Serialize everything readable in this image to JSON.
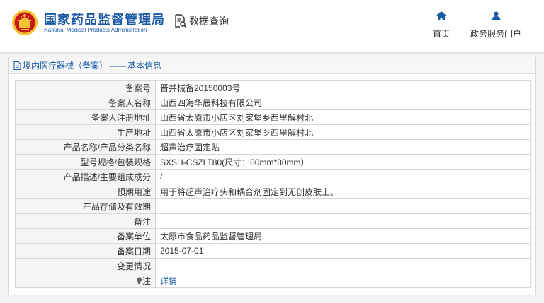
{
  "header": {
    "brand_cn": "国家药品监督管理局",
    "brand_en": "National Medical Products Administration",
    "query_label": "数据查询",
    "nav": [
      {
        "label": "首页",
        "icon": "home-icon"
      },
      {
        "label": "政务服务门户",
        "icon": "user-icon"
      }
    ]
  },
  "panel": {
    "title_left": "境内医疗器械（备案）",
    "title_sep": "——",
    "title_right": "基本信息"
  },
  "rows": [
    {
      "label": "备案号",
      "value": "晋并械备20150003号"
    },
    {
      "label": "备案人名称",
      "value": "山西四海华辰科技有限公司"
    },
    {
      "label": "备案人注册地址",
      "value": "山西省太原市小店区刘家堡乡西里解村北"
    },
    {
      "label": "生产地址",
      "value": "山西省太原市小店区刘家堡乡西里解村北"
    },
    {
      "label": "产品名称/产品分类名称",
      "value": "超声治疗固定贴"
    },
    {
      "label": "型号规格/包装规格",
      "value": "SXSH-CSZLT80(尺寸：80mm*80mm）"
    },
    {
      "label": "产品描述/主要组成成分",
      "value": "/"
    },
    {
      "label": "预期用途",
      "value": "用于将超声治疗头和耦合剂固定到无创皮肤上。"
    },
    {
      "label": "产品存储及有效期",
      "value": ""
    },
    {
      "label": "备注",
      "value": ""
    },
    {
      "label": "备案单位",
      "value": "太原市食品药品监督管理局"
    },
    {
      "label": "备案日期",
      "value": "2015-07-01"
    },
    {
      "label": "变更情况",
      "value": ""
    },
    {
      "label": "注",
      "value": "详情"
    }
  ],
  "colors": {
    "brand": "#1c5aa8",
    "emblem_red": "#c8161d",
    "emblem_gold": "#f1c232"
  }
}
